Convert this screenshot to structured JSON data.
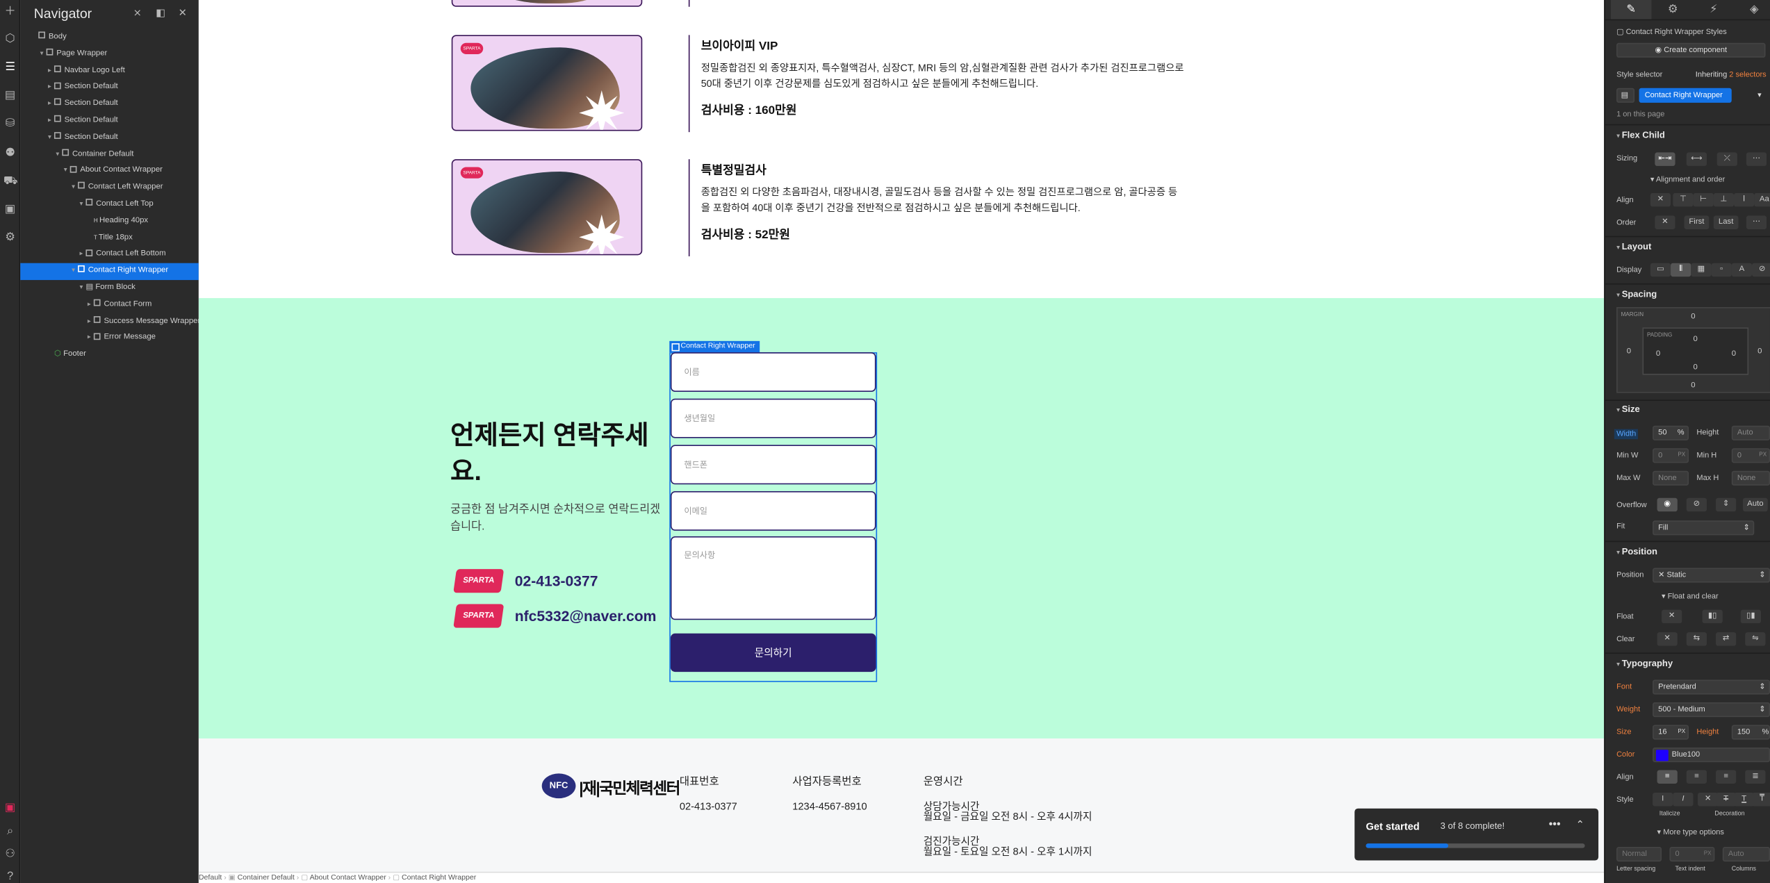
{
  "navigator": {
    "title": "Navigator",
    "tree": [
      {
        "label": "Body",
        "depth": 0,
        "caret": "",
        "icon": "box"
      },
      {
        "label": "Page Wrapper",
        "depth": 1,
        "caret": "▾",
        "icon": "box"
      },
      {
        "label": "Navbar Logo Left",
        "depth": 2,
        "caret": "▸",
        "icon": "box"
      },
      {
        "label": "Section Default",
        "depth": 2,
        "caret": "▸",
        "icon": "box"
      },
      {
        "label": "Section Default",
        "depth": 2,
        "caret": "▸",
        "icon": "box"
      },
      {
        "label": "Section Default",
        "depth": 2,
        "caret": "▸",
        "icon": "box"
      },
      {
        "label": "Section Default",
        "depth": 2,
        "caret": "▾",
        "icon": "box"
      },
      {
        "label": "Container Default",
        "depth": 3,
        "caret": "▾",
        "icon": "box"
      },
      {
        "label": "About Contact Wrapper",
        "depth": 4,
        "caret": "▾",
        "icon": "box"
      },
      {
        "label": "Contact Left Wrapper",
        "depth": 5,
        "caret": "▾",
        "icon": "box"
      },
      {
        "label": "Contact Left Top",
        "depth": 6,
        "caret": "▾",
        "icon": "box"
      },
      {
        "label": "Heading 40px",
        "depth": 7,
        "caret": "",
        "icon": "H"
      },
      {
        "label": "Title 18px",
        "depth": 7,
        "caret": "",
        "icon": "T"
      },
      {
        "label": "Contact Left Bottom",
        "depth": 6,
        "caret": "▸",
        "icon": "box"
      },
      {
        "label": "Contact Right Wrapper",
        "depth": 5,
        "caret": "▾",
        "icon": "box",
        "selected": true
      },
      {
        "label": "Form Block",
        "depth": 6,
        "caret": "▾",
        "icon": "form"
      },
      {
        "label": "Contact Form",
        "depth": 7,
        "caret": "▸",
        "icon": "box"
      },
      {
        "label": "Success Message Wrapper",
        "depth": 7,
        "caret": "▸",
        "icon": "box"
      },
      {
        "label": "Error Message",
        "depth": 7,
        "caret": "▸",
        "icon": "box"
      },
      {
        "label": "Footer",
        "depth": 2,
        "caret": "",
        "icon": "comp"
      }
    ]
  },
  "services": [
    {
      "badge": "SPARTA",
      "title": "브이아이피 VIP",
      "desc": "정밀종합검진 외 종양표지자, 특수혈액검사, 심장CT, MRI 등의 암,심혈관계질환 관련 검사가 추가된 검진프로그램으로 50대 중년기 이후 건강문제를 심도있게 점검하시고 싶은 분들에게 추천해드립니다.",
      "price": "검사비용 : 160만원"
    },
    {
      "badge": "SPARTA",
      "title": "특별정밀검사",
      "desc": "종합검진 외 다양한 초음파검사, 대장내시경, 골밀도검사 등을 검사할 수 있는 정밀 검진프로그램으로 암, 골다공증 등을 포함하여 40대 이후 중년기 건강을 전반적으로 점검하시고 싶은 분들에게 추천해드립니다.",
      "price": "검사비용 : 52만원"
    }
  ],
  "contact": {
    "title": "언제든지 연락주세요.",
    "desc": "궁금한 점 남겨주시면 순차적으로 연락드리겠습니다.",
    "logo_text": "SPARTA",
    "phone": "02-413-0377",
    "email": "nfc5332@naver.com",
    "selection_label": "Contact Right Wrapper",
    "fields": {
      "name": "이름",
      "birth": "생년월일",
      "mobile": "핸드폰",
      "email": "이메일",
      "inquiry": "문의사항"
    },
    "submit": "문의하기"
  },
  "footer": {
    "logo_mark": "NFC",
    "logo_name": "|재|국민체력센터",
    "rep_label": "대표번호",
    "rep_value": "02-413-0377",
    "biz_label": "사업자등록번호",
    "biz_value": "1234-4567-8910",
    "hours_label": "운영시간",
    "hours_consult_title": "상담가능시간",
    "hours_consult": "월요일 - 금요일 오전 8시 - 오후 4시까지",
    "hours_exam_title": "검진가능시간",
    "hours_exam": "월요일 - 토요일 오전 8시 - 오후 1시까지"
  },
  "breadcrumb": [
    "Default",
    "Container Default",
    "About Contact Wrapper",
    "Contact Right Wrapper"
  ],
  "toast": {
    "title": "Get started",
    "count": "3 of 8 complete!",
    "progress": 0.375
  },
  "panel": {
    "styles_label": "Contact Right Wrapper Styles",
    "create_component": "Create component",
    "style_selector": "Style selector",
    "inheriting": "Inheriting",
    "inheriting_count": "2 selectors",
    "selector_value": "Contact Right Wrapper",
    "on_page": "1 on this page",
    "flex_child": "Flex Child",
    "sizing": "Sizing",
    "align_order": "Alignment and order",
    "align": "Align",
    "order": "Order",
    "order_first": "First",
    "order_last": "Last",
    "layout": "Layout",
    "display": "Display",
    "spacing": "Spacing",
    "margin": "MARGIN",
    "padding": "PADDING",
    "zero": "0",
    "size": "Size",
    "width": "Width",
    "width_val": "50",
    "width_unit": "%",
    "height": "Height",
    "auto": "Auto",
    "min_w": "Min W",
    "min_h": "Min H",
    "max_w": "Max W",
    "max_h": "Max H",
    "none": "None",
    "px": "PX",
    "overflow": "Overflow",
    "overflow_auto": "Auto",
    "fit": "Fit",
    "fit_val": "Fill",
    "position": "Position",
    "position_val": "Static",
    "float_clear": "Float and clear",
    "float": "Float",
    "clear": "Clear",
    "typography": "Typography",
    "font": "Font",
    "font_val": "Pretendard",
    "weight": "Weight",
    "weight_val": "500 - Medium",
    "size_label": "Size",
    "size_val": "16",
    "line_height": "Height",
    "line_height_val": "150",
    "color": "Color",
    "color_val": "Blue100",
    "color_hex": "#1e00ff",
    "align_t": "Align",
    "style": "Style",
    "italicize": "Italicize",
    "decoration": "Decoration",
    "more_type": "More type options",
    "normal": "Normal",
    "letter_spacing": "Letter spacing",
    "text_indent": "Text indent",
    "columns": "Columns"
  },
  "colors": {
    "accent": "#1473e6",
    "mint": "#bbfddb",
    "navy": "#2c1f6c",
    "sparta": "#e0285a"
  }
}
